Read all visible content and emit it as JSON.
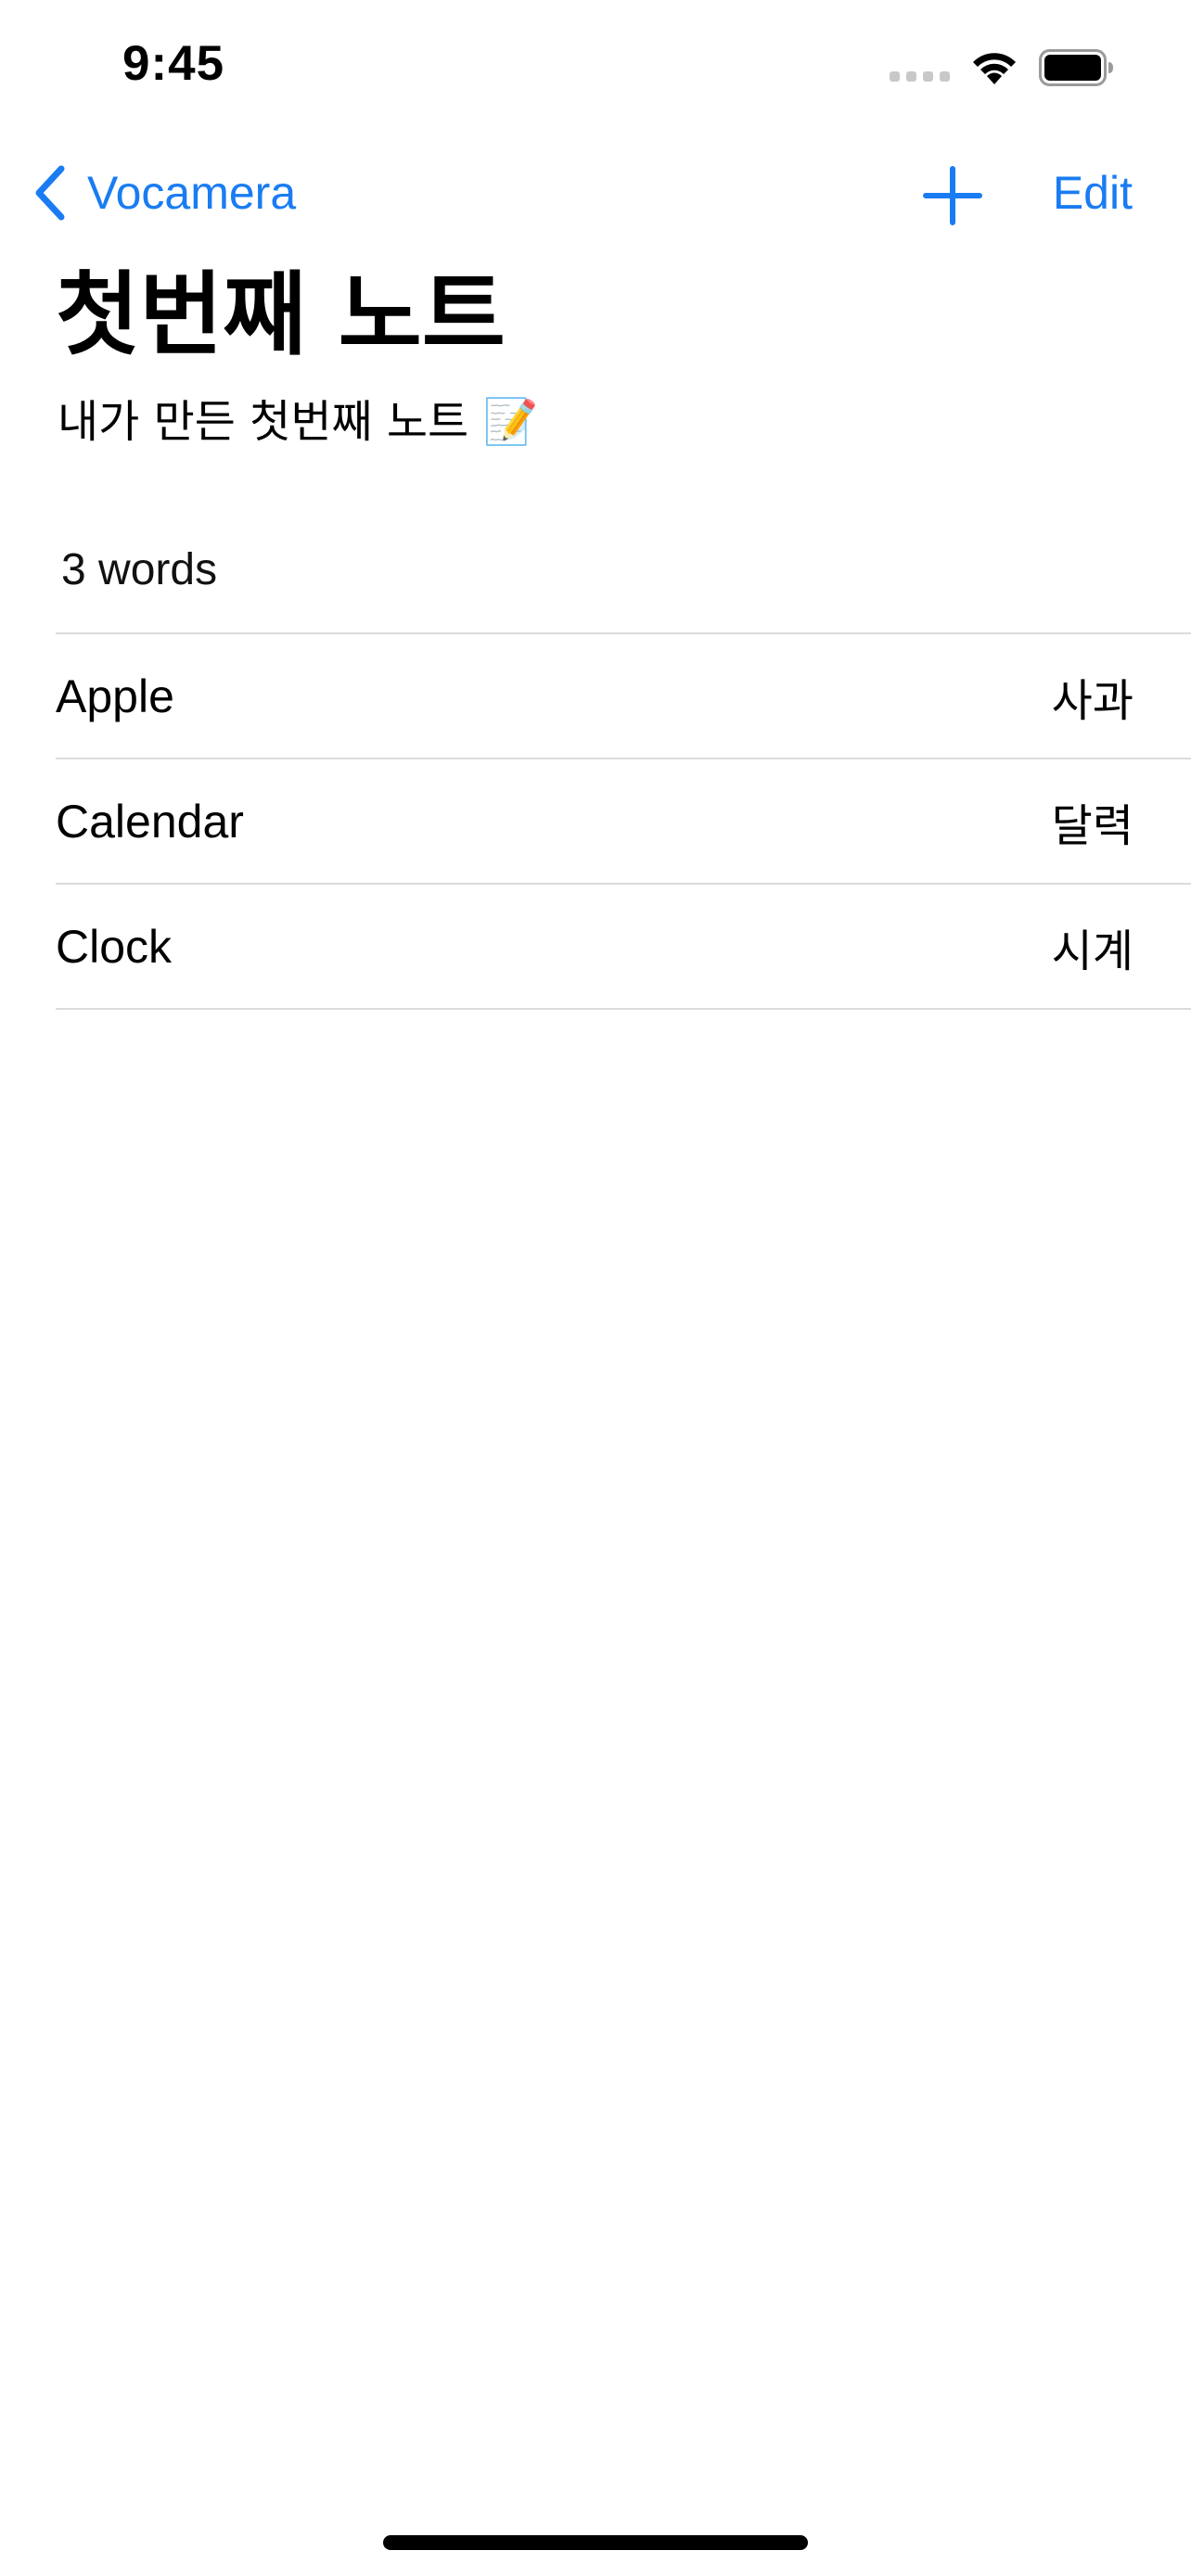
{
  "status_bar": {
    "time": "9:45",
    "icons": [
      "cellular-signal-icon",
      "wifi-icon",
      "battery-icon"
    ]
  },
  "nav": {
    "back_label": "Vocamera",
    "back_icon": "chevron-left-icon",
    "add_icon": "plus-icon",
    "edit_label": "Edit",
    "accent_color": "#1a7cf3"
  },
  "note": {
    "title": "첫번째 노트",
    "subtitle": "내가 만든 첫번째 노트 📝"
  },
  "word_list": {
    "count_label": "3 words",
    "items": [
      {
        "term": "Apple",
        "meaning": "사과"
      },
      {
        "term": "Calendar",
        "meaning": "달력"
      },
      {
        "term": "Clock",
        "meaning": "시계"
      }
    ]
  }
}
